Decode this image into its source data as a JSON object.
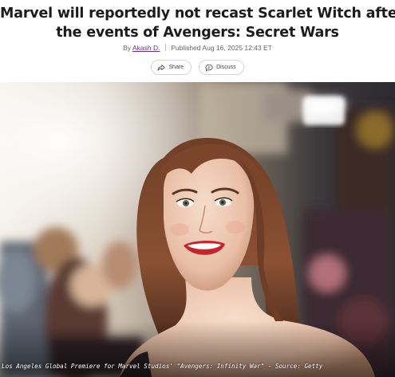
{
  "article": {
    "headline_line1": "Marvel will reportedly not recast Scarlet Witch after",
    "headline_line2": "the events of Avengers: Secret Wars",
    "byline_prefix": "By",
    "author": "Akash D.",
    "published": "Published Aug 16, 2025 12:43 ET"
  },
  "actions": {
    "share_label": "Share",
    "share_icon": "share-arrow-icon",
    "discuss_label": "Discuss",
    "discuss_icon": "speech-bubble-icon"
  },
  "hero": {
    "caption": "Los Angeles Global Premiere for Marvel Studios' \"Avengers: Infinity War\" - Source: Getty"
  },
  "colors": {
    "headline": "#1c1c1c",
    "author_link": "#6b2c91",
    "meta": "#666666",
    "pill_border": "#d4d4d4"
  }
}
